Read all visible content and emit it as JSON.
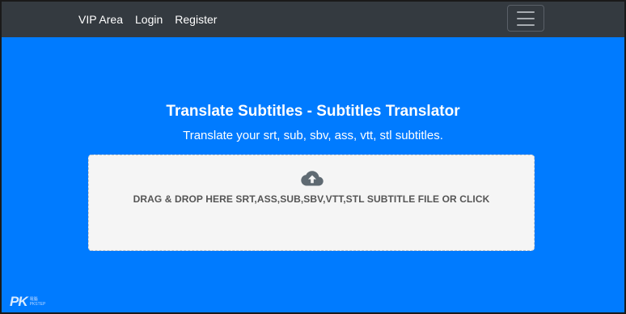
{
  "navbar": {
    "links": [
      {
        "label": "VIP Area"
      },
      {
        "label": "Login"
      },
      {
        "label": "Register"
      }
    ]
  },
  "hero": {
    "title": "Translate Subtitles - Subtitles Translator",
    "subtitle": "Translate your srt, sub, sbv, ass, vtt, stl subtitles."
  },
  "dropzone": {
    "label": "DRAG & DROP HERE SRT,ASS,SUB,SBV,VTT,STL SUBTITLE FILE OR CLICK",
    "icon": "cloud-upload-icon"
  },
  "watermark": {
    "logo": "PK",
    "line1": "電腦",
    "line2": "PKSTEP"
  },
  "colors": {
    "navbar_bg": "#343a40",
    "page_bg": "#007bff",
    "dropzone_bg": "#f5f5f5",
    "dropzone_text": "#555555"
  }
}
